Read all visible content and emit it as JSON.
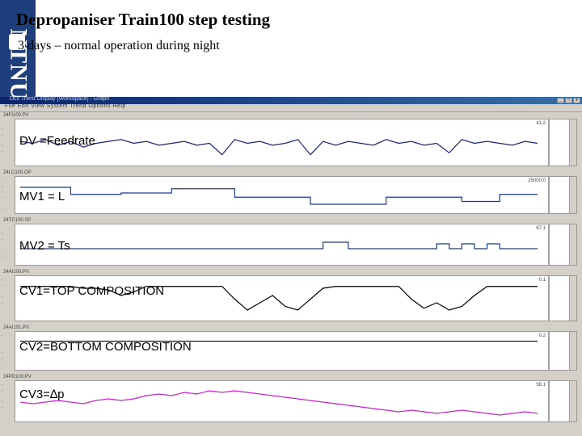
{
  "slide": {
    "title": "Depropaniser Train100 step testing",
    "bullet": "3 days – normal operation during night",
    "logo_text": "NTNU"
  },
  "window": {
    "title_text": "Dcs Trend Display [Workspace] - Graph",
    "menu_text": "File  Edit  View  System  Trend  Options  Help"
  },
  "panels": [
    {
      "id": "dv",
      "label": "DV =Feedrate",
      "tag": "24FI100.PV",
      "value": "41.2",
      "color": "#1a237e",
      "bg": "#ffffff"
    },
    {
      "id": "mv1",
      "label": "MV1 = L",
      "tag": "24LC100.OP",
      "value": "25000.0",
      "color": "#1a3a8f",
      "bg": "#ffffff"
    },
    {
      "id": "mv2",
      "label": "MV2 = Ts",
      "tag": "24TC100.SP",
      "value": "67.1",
      "color": "#1a3a8f",
      "bg": "#ffffff"
    },
    {
      "id": "cv1",
      "label": "CV1=TOP COMPOSITION",
      "tag": "24AI100.PV",
      "value": "0.1",
      "color": "#000000",
      "bg": "#ffffff"
    },
    {
      "id": "cv2",
      "label": "CV2=BOTTOM COMPOSITION",
      "tag": "24AI101.PV",
      "value": "0.2",
      "color": "#000000",
      "bg": "#ffffff"
    },
    {
      "id": "cv3",
      "label": "CV3=∆p",
      "tag": "24PD100.PV",
      "value": "58.1",
      "color": "#cc22cc",
      "bg": "#ffffff"
    }
  ],
  "chart_data": {
    "type": "line",
    "series": [
      {
        "name": "DV =Feedrate",
        "values": [
          0.55,
          0.5,
          0.6,
          0.45,
          0.55,
          0.4,
          0.5,
          0.55,
          0.6,
          0.5,
          0.55,
          0.45,
          0.5,
          0.55,
          0.45,
          0.5,
          0.2,
          0.6,
          0.5,
          0.55,
          0.45,
          0.5,
          0.6,
          0.2,
          0.55,
          0.45,
          0.55,
          0.5,
          0.45,
          0.6,
          0.5,
          0.55,
          0.45,
          0.5,
          0.25,
          0.6,
          0.5,
          0.55,
          0.5,
          0.45,
          0.55,
          0.5
        ]
      },
      {
        "name": "MV1 = L",
        "values": [
          0.8,
          0.8,
          0.8,
          0.8,
          0.55,
          0.55,
          0.55,
          0.55,
          0.6,
          0.6,
          0.6,
          0.6,
          0.75,
          0.75,
          0.75,
          0.75,
          0.75,
          0.45,
          0.45,
          0.45,
          0.45,
          0.45,
          0.45,
          0.2,
          0.2,
          0.2,
          0.2,
          0.2,
          0.2,
          0.45,
          0.45,
          0.45,
          0.45,
          0.45,
          0.45,
          0.3,
          0.3,
          0.3,
          0.55,
          0.55,
          0.55,
          0.55
        ]
      },
      {
        "name": "MV2 = Ts",
        "values": [
          0.4,
          0.4,
          0.4,
          0.4,
          0.4,
          0.4,
          0.4,
          0.4,
          0.4,
          0.4,
          0.4,
          0.4,
          0.4,
          0.4,
          0.4,
          0.4,
          0.4,
          0.4,
          0.4,
          0.4,
          0.4,
          0.4,
          0.4,
          0.4,
          0.6,
          0.6,
          0.4,
          0.4,
          0.4,
          0.4,
          0.4,
          0.4,
          0.4,
          0.55,
          0.4,
          0.55,
          0.4,
          0.55,
          0.4,
          0.4,
          0.4,
          0.4
        ]
      },
      {
        "name": "CV1=TOP COMPOSITION",
        "values": [
          0.85,
          0.85,
          0.85,
          0.85,
          0.85,
          0.8,
          0.8,
          0.75,
          0.6,
          0.7,
          0.85,
          0.85,
          0.85,
          0.85,
          0.85,
          0.85,
          0.85,
          0.5,
          0.2,
          0.4,
          0.6,
          0.3,
          0.2,
          0.5,
          0.8,
          0.85,
          0.85,
          0.85,
          0.85,
          0.85,
          0.85,
          0.5,
          0.25,
          0.4,
          0.2,
          0.3,
          0.6,
          0.85,
          0.85,
          0.85,
          0.85,
          0.85
        ]
      },
      {
        "name": "CV2=BOTTOM COMPOSITION",
        "values": [
          0.85,
          0.85,
          0.85,
          0.85,
          0.85,
          0.85,
          0.85,
          0.85,
          0.85,
          0.85,
          0.85,
          0.85,
          0.85,
          0.85,
          0.85,
          0.85,
          0.85,
          0.85,
          0.85,
          0.85,
          0.85,
          0.85,
          0.85,
          0.85,
          0.85,
          0.85,
          0.85,
          0.85,
          0.85,
          0.85,
          0.85,
          0.85,
          0.85,
          0.85,
          0.85,
          0.85,
          0.85,
          0.85,
          0.85,
          0.85,
          0.85,
          0.85
        ]
      },
      {
        "name": "CV3=∆p",
        "values": [
          0.5,
          0.45,
          0.5,
          0.55,
          0.5,
          0.45,
          0.55,
          0.6,
          0.55,
          0.6,
          0.7,
          0.75,
          0.7,
          0.8,
          0.75,
          0.85,
          0.8,
          0.85,
          0.8,
          0.75,
          0.7,
          0.65,
          0.6,
          0.55,
          0.5,
          0.45,
          0.4,
          0.35,
          0.3,
          0.25,
          0.2,
          0.25,
          0.2,
          0.15,
          0.2,
          0.25,
          0.2,
          0.15,
          0.1,
          0.15,
          0.2,
          0.15
        ]
      }
    ]
  }
}
